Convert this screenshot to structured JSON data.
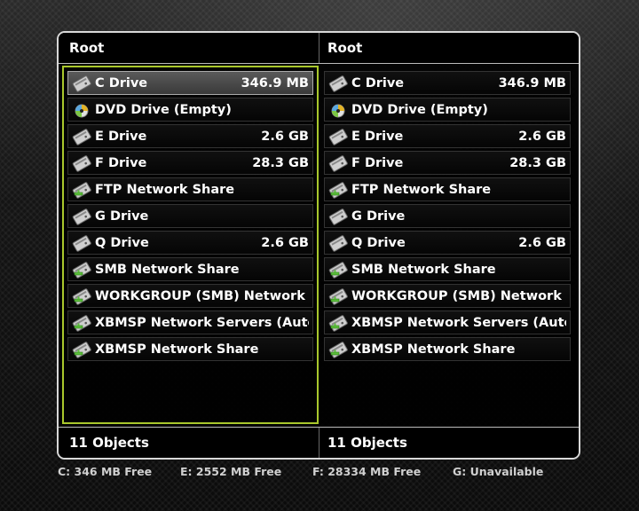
{
  "panes": [
    {
      "title": "Root",
      "footer": "11 Objects",
      "items": [
        {
          "name": "C Drive",
          "size": "346.9 MB",
          "icon": "hdd-icon",
          "selected": true
        },
        {
          "name": "DVD Drive (Empty)",
          "size": "",
          "icon": "dvd-icon"
        },
        {
          "name": "E Drive",
          "size": "2.6 GB",
          "icon": "hdd-icon"
        },
        {
          "name": "F Drive",
          "size": "28.3 GB",
          "icon": "hdd-icon"
        },
        {
          "name": "FTP Network Share",
          "size": "",
          "icon": "network-drive-icon"
        },
        {
          "name": "G Drive",
          "size": "",
          "icon": "hdd-icon"
        },
        {
          "name": "Q Drive",
          "size": "2.6 GB",
          "icon": "hdd-icon"
        },
        {
          "name": "SMB Network Share",
          "size": "",
          "icon": "network-drive-icon"
        },
        {
          "name": "WORKGROUP (SMB) Network",
          "size": "",
          "icon": "network-drive-icon"
        },
        {
          "name": "XBMSP Network Servers (Auto-Dis",
          "size": "",
          "icon": "network-drive-icon"
        },
        {
          "name": "XBMSP Network Share",
          "size": "",
          "icon": "network-drive-icon"
        }
      ]
    },
    {
      "title": "Root",
      "footer": "11 Objects",
      "items": [
        {
          "name": "C Drive",
          "size": "346.9 MB",
          "icon": "hdd-icon"
        },
        {
          "name": "DVD Drive (Empty)",
          "size": "",
          "icon": "dvd-icon"
        },
        {
          "name": "E Drive",
          "size": "2.6 GB",
          "icon": "hdd-icon"
        },
        {
          "name": "F Drive",
          "size": "28.3 GB",
          "icon": "hdd-icon"
        },
        {
          "name": "FTP Network Share",
          "size": "",
          "icon": "network-drive-icon"
        },
        {
          "name": "G Drive",
          "size": "",
          "icon": "hdd-icon"
        },
        {
          "name": "Q Drive",
          "size": "2.6 GB",
          "icon": "hdd-icon"
        },
        {
          "name": "SMB Network Share",
          "size": "",
          "icon": "network-drive-icon"
        },
        {
          "name": "WORKGROUP (SMB) Network",
          "size": "",
          "icon": "network-drive-icon"
        },
        {
          "name": "XBMSP Network Servers (Auto-Dis",
          "size": "",
          "icon": "network-drive-icon"
        },
        {
          "name": "XBMSP Network Share",
          "size": "",
          "icon": "network-drive-icon"
        }
      ]
    }
  ],
  "status": [
    {
      "text": "C: 346 MB Free"
    },
    {
      "text": "E: 2552 MB Free"
    },
    {
      "text": "F: 28334 MB Free"
    },
    {
      "text": "G: Unavailable"
    }
  ],
  "colors": {
    "focus_border": "#a9c72c",
    "network_badge": "#5bbf3a"
  }
}
